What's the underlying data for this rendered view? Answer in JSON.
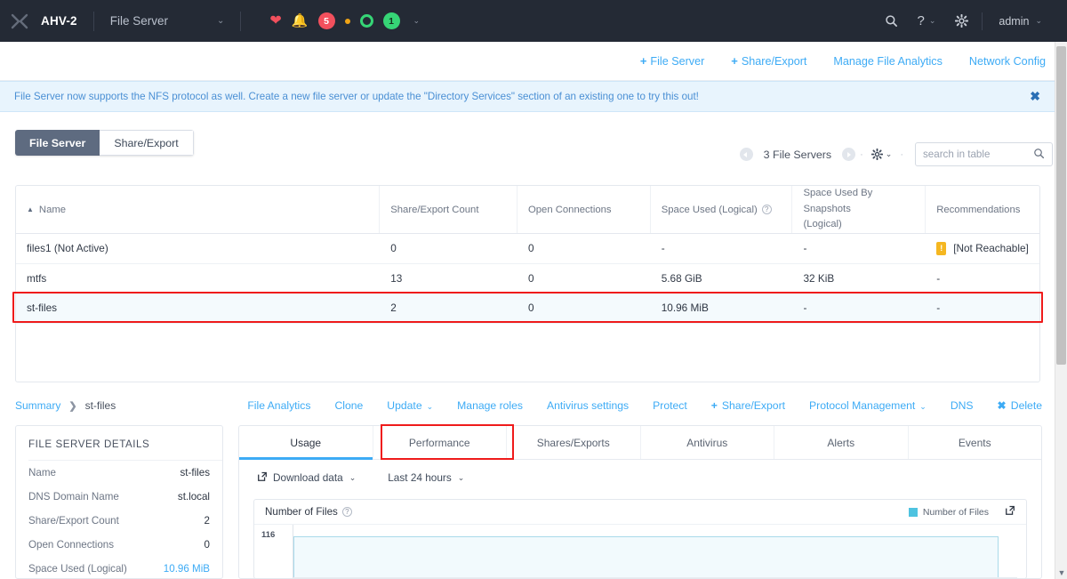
{
  "topbar": {
    "logo_icon": "nutanix-x-icon",
    "cluster": "AHV-2",
    "context": "File Server",
    "context_caret": "⌄",
    "health_icon": "heart-pulse-icon",
    "bell_icon": "bell-icon",
    "alert_badge": "5",
    "warn_dot": "orange-dot-icon",
    "ok_ring": "green-ring-icon",
    "task_badge": "1",
    "status_caret": "⌄",
    "search_icon": "search-icon",
    "help_icon": "?",
    "help_caret": "⌄",
    "gear_icon": "gear-icon",
    "user": "admin",
    "user_caret": "⌄"
  },
  "actions": [
    {
      "label": "File Server",
      "plus": "+"
    },
    {
      "label": "Share/Export",
      "plus": "+"
    },
    {
      "label": "Manage File Analytics",
      "plus": ""
    },
    {
      "label": "Network Config",
      "plus": ""
    }
  ],
  "banner": {
    "text": "File Server now supports the NFS protocol as well. Create a new file server or update the \"Directory Services\" section of an existing one to try this out!",
    "close_icon": "✖"
  },
  "segmented": {
    "active": "File Server",
    "inactive": "Share/Export"
  },
  "toolbar": {
    "count": "3 File Servers",
    "gear_icon": "gear-icon",
    "gear_caret": "⌄",
    "search_placeholder": "search in table",
    "search_value": "",
    "search_icon": "⌕",
    "prev_icon": "prev-page-icon",
    "next_icon": "next-page-icon",
    "dot": "·"
  },
  "table": {
    "sort_caret": "▲",
    "columns": [
      "Name",
      "Share/Export Count",
      "Open Connections",
      "Space Used (Logical)",
      "Space Used By Snapshots (Logical)",
      "Recommendations"
    ],
    "col_space_used": "Space Used (Logical)",
    "col_snap_1": "Space Used By Snapshots",
    "col_snap_2": "(Logical)",
    "rows": [
      {
        "name": "files1 (Not Active)",
        "shares": "0",
        "connections": "0",
        "space_used": "-",
        "snapshots": "-",
        "recommendations": "[Not Reachable]",
        "warn": "!",
        "selected": false
      },
      {
        "name": "mtfs",
        "shares": "13",
        "connections": "0",
        "space_used": "5.68 GiB",
        "snapshots": "32 KiB",
        "recommendations": "-",
        "warn": "",
        "selected": false
      },
      {
        "name": "st-files",
        "shares": "2",
        "connections": "0",
        "space_used": "10.96 MiB",
        "snapshots": "-",
        "recommendations": "-",
        "warn": "",
        "selected": true
      }
    ]
  },
  "summary": {
    "breadcrumb_link": "Summary",
    "breadcrumb_sep": "❯",
    "breadcrumb_current": "st-files",
    "actions": [
      {
        "label": "File Analytics",
        "glyph": "",
        "caret": ""
      },
      {
        "label": "Clone",
        "glyph": "",
        "caret": ""
      },
      {
        "label": "Update",
        "glyph": "",
        "caret": "⌄"
      },
      {
        "label": "Manage roles",
        "glyph": "",
        "caret": ""
      },
      {
        "label": "Antivirus settings",
        "glyph": "",
        "caret": ""
      },
      {
        "label": "Protect",
        "glyph": "",
        "caret": ""
      },
      {
        "label": "Share/Export",
        "glyph": "+",
        "caret": ""
      },
      {
        "label": "Protocol Management",
        "glyph": "",
        "caret": "⌄"
      },
      {
        "label": "DNS",
        "glyph": "",
        "caret": ""
      },
      {
        "label": "Delete",
        "glyph": "✖",
        "caret": ""
      }
    ]
  },
  "details": {
    "title": "FILE SERVER DETAILS",
    "rows": [
      {
        "label": "Name",
        "value": "st-files",
        "link": false
      },
      {
        "label": "DNS Domain Name",
        "value": "st.local",
        "link": false
      },
      {
        "label": "Share/Export Count",
        "value": "2",
        "link": false
      },
      {
        "label": "Open Connections",
        "value": "0",
        "link": false
      },
      {
        "label": "Space Used (Logical)",
        "value": "10.96 MiB",
        "link": true
      }
    ]
  },
  "tabs": [
    {
      "label": "Usage",
      "active": true
    },
    {
      "label": "Performance",
      "active": false
    },
    {
      "label": "Shares/Exports",
      "active": false
    },
    {
      "label": "Antivirus",
      "active": false,
      "highlighted": true
    },
    {
      "label": "Alerts",
      "active": false
    },
    {
      "label": "Events",
      "active": false
    }
  ],
  "chart_controls": {
    "download_icon": "external-link-icon",
    "download_label": "Download data",
    "download_caret": "⌄",
    "range_label": "Last 24 hours",
    "range_caret": "⌄"
  },
  "chart_data": {
    "type": "area",
    "title": "Number of Files",
    "help_icon": "?",
    "legend": [
      "Number of Files"
    ],
    "legend_position": "top-right",
    "popout_icon": "popout-icon",
    "xlabel": "",
    "ylabel": "",
    "ytick_labels": [
      "116"
    ],
    "ylim": [
      0,
      116
    ],
    "series": [
      {
        "name": "Number of Files",
        "values": [
          116,
          116,
          116,
          116,
          116,
          116,
          116,
          116,
          116,
          116,
          116,
          116
        ]
      }
    ],
    "color": "#4ec3e0",
    "grid": false
  },
  "scrollbar": {
    "down_arrow": "▼"
  },
  "colors": {
    "accent": "#3dabf5",
    "nav_bg": "#242a35",
    "alert_red": "#f2505d",
    "ok_green": "#36d576",
    "warn_amber": "#f5b721",
    "highlight_red": "#ef1b1b",
    "series_blue": "#4ec3e0"
  }
}
